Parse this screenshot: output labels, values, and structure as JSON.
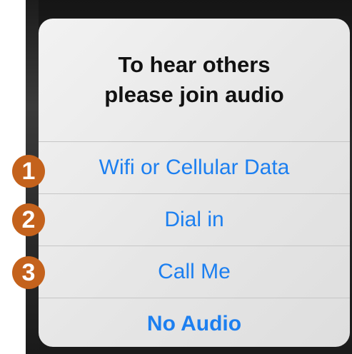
{
  "dialog": {
    "title_line1": "To hear others",
    "title_line2": "please join audio",
    "options": [
      {
        "label": "Wifi or Cellular Data",
        "marker": "1"
      },
      {
        "label": "Dial in",
        "marker": "2"
      },
      {
        "label": "Call Me",
        "marker": "3"
      },
      {
        "label": "No Audio"
      }
    ]
  },
  "colors": {
    "option_text": "#1c7ff0",
    "marker_fill": "#c4621c",
    "title_text": "#111111"
  }
}
